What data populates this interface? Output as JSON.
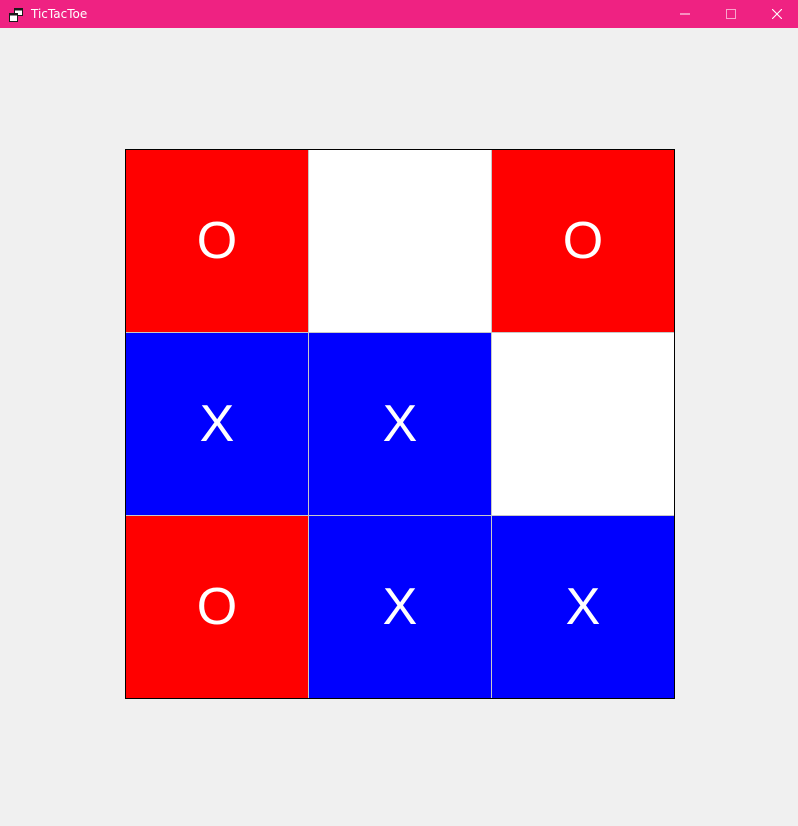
{
  "window": {
    "title": "TicTacToe",
    "titlebar_color": "#ef2282",
    "icons": {
      "app": "app-window-icon",
      "minimize": "minimize-icon",
      "maximize": "maximize-icon",
      "close": "close-icon"
    }
  },
  "board": {
    "colors": {
      "O": "#ff0000",
      "X": "#0000ff",
      "empty": "#ffffff"
    },
    "cells": [
      {
        "mark": "O"
      },
      {
        "mark": ""
      },
      {
        "mark": "O"
      },
      {
        "mark": "X"
      },
      {
        "mark": "X"
      },
      {
        "mark": ""
      },
      {
        "mark": "O"
      },
      {
        "mark": "X"
      },
      {
        "mark": "X"
      }
    ]
  }
}
